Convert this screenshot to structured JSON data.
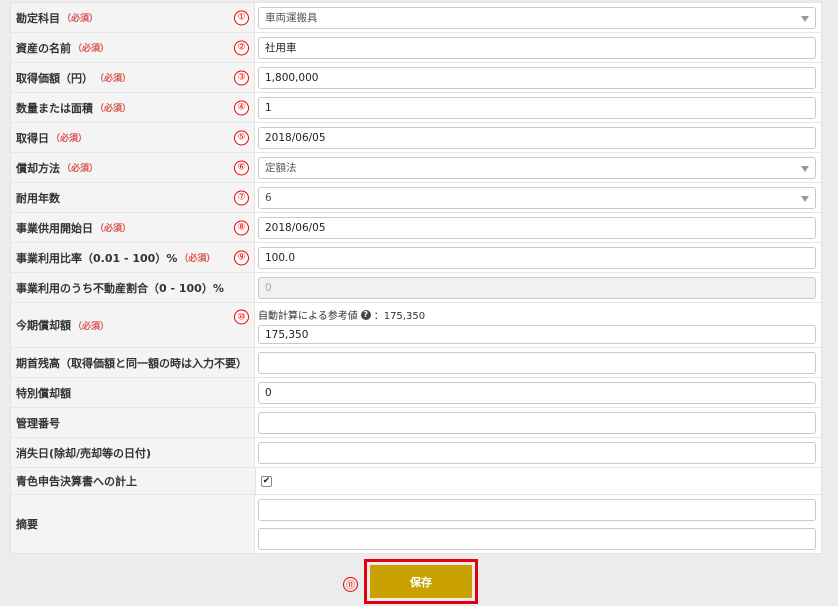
{
  "form": {
    "rows": [
      {
        "label": "勘定科目",
        "req": "（必須）",
        "num": "①",
        "value": "車両運搬具"
      },
      {
        "label": "資産の名前",
        "req": "（必須）",
        "num": "②",
        "value": "社用車"
      },
      {
        "label": "取得価額（円）",
        "req": "（必須）",
        "num": "③",
        "value": "1,800,000"
      },
      {
        "label": "数量または面積",
        "req": "（必須）",
        "num": "④",
        "value": "1"
      },
      {
        "label": "取得日",
        "req": "（必須）",
        "num": "⑤",
        "value": "2018/06/05"
      },
      {
        "label": "償却方法",
        "req": "（必須）",
        "num": "⑥",
        "value": "定額法"
      },
      {
        "label": "耐用年数",
        "req": "",
        "num": "⑦",
        "value": "6"
      },
      {
        "label": "事業供用開始日",
        "req": "（必須）",
        "num": "⑧",
        "value": "2018/06/05"
      },
      {
        "label": "事業利用比率（0.01 - 100）%",
        "req": "（必須）",
        "num": "⑨",
        "value": "100.0"
      },
      {
        "label": "事業利用のうち不動産割合（0 - 100）%",
        "req": "",
        "num": "",
        "placeholder": "0"
      },
      {
        "label": "今期償却額",
        "req": "（必須）",
        "num": "⑩",
        "hint_text": "自動計算による参考値",
        "hint_value": "：175,350",
        "value": "175,350"
      },
      {
        "label": "期首残高（取得価額と同一額の時は入力不要）",
        "value": ""
      },
      {
        "label": "特別償却額",
        "value": "0"
      },
      {
        "label": "管理番号",
        "value": ""
      },
      {
        "label": "消失日(除却/売却等の日付)",
        "value": ""
      },
      {
        "label": "青色申告決算書への計上",
        "checked": "✔"
      },
      {
        "label": "摘要",
        "value1": "",
        "value2": ""
      }
    ]
  },
  "save": {
    "label": "保存",
    "num": "⑪"
  },
  "colors": {
    "required": "#d9534f",
    "annotation": "#ee0000",
    "save_button": "#c9a100"
  }
}
